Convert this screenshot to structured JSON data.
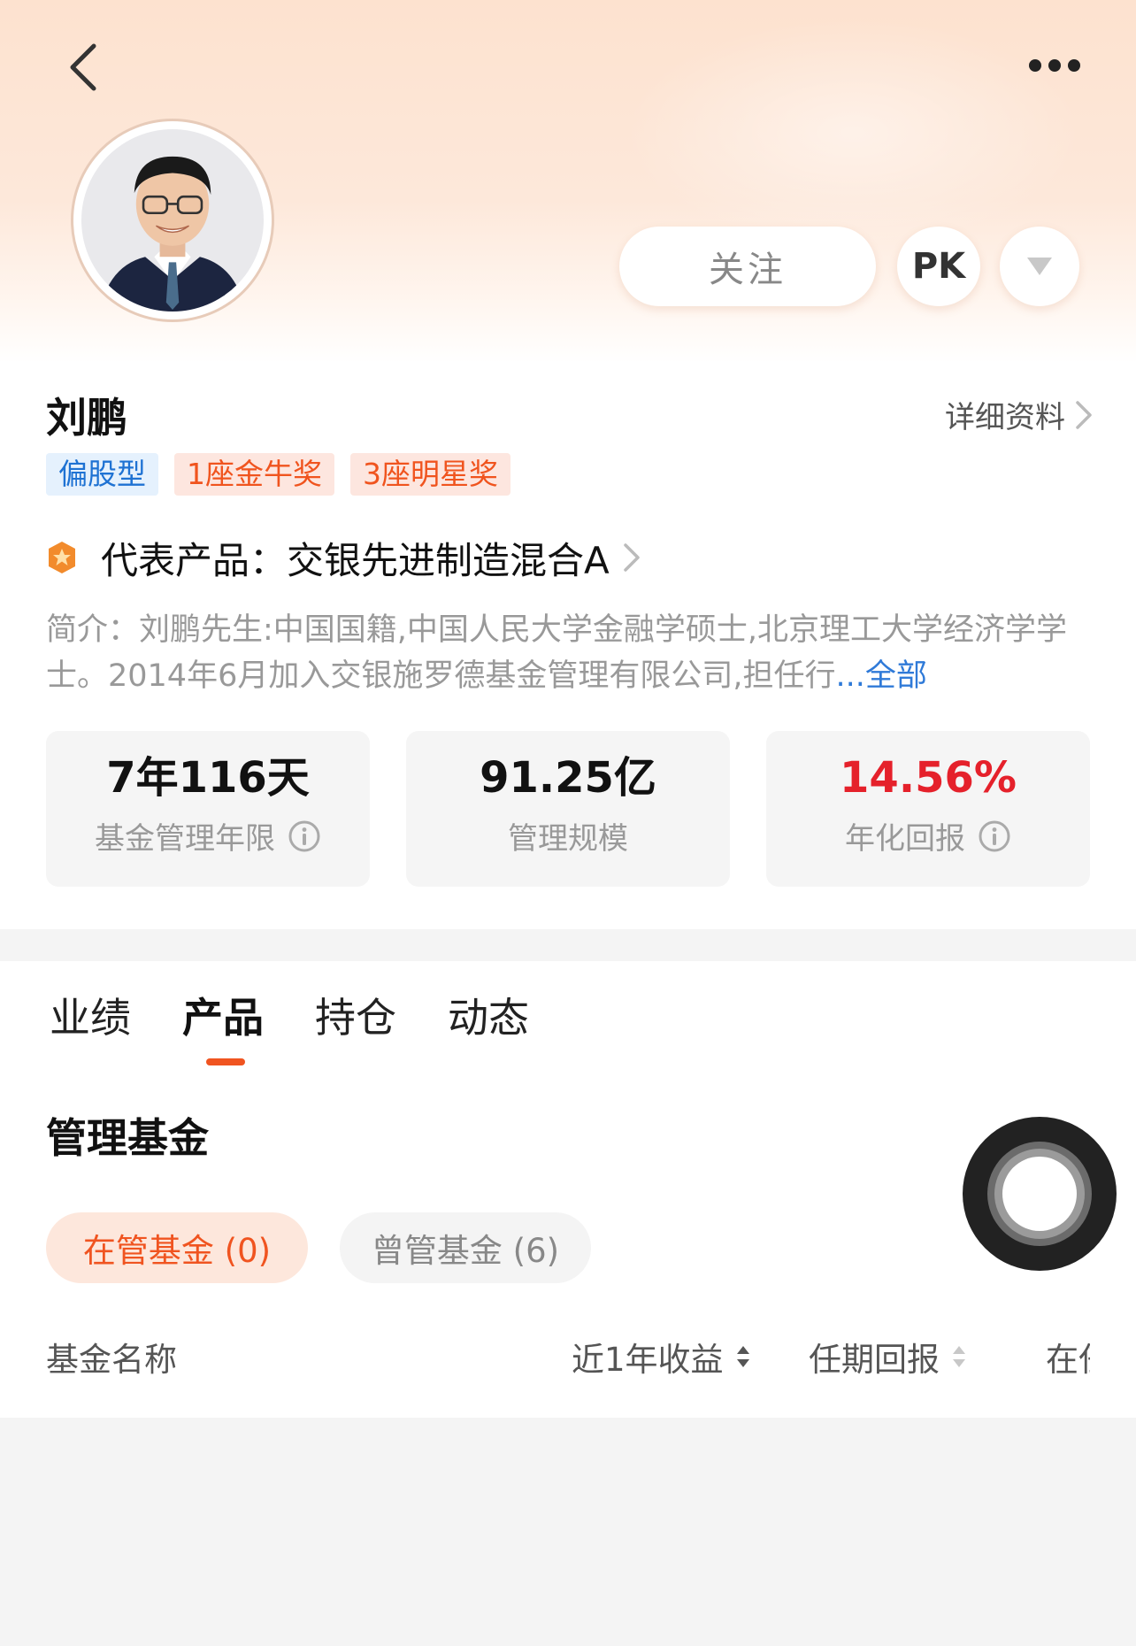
{
  "nav": {
    "back_icon": "chevron-left-icon",
    "more_icon": "more-horizontal-icon"
  },
  "actions": {
    "follow_label": "关注",
    "pk_label": "PK",
    "dropdown_icon": "triangle-down-icon"
  },
  "manager": {
    "name": "刘鹏",
    "detail_link": "详细资料",
    "tags": [
      {
        "label": "偏股型",
        "color": "#1e72d3"
      },
      {
        "label": "1座金牛奖",
        "color": "#f0541e"
      },
      {
        "label": "3座明星奖",
        "color": "#f0541e"
      }
    ],
    "rep_product_label": "代表产品：",
    "rep_product_name": "交银先进制造混合A",
    "intro_text": "简介：刘鹏先生:中国国籍,中国人民大学金融学硕士,北京理工大学经济学学士。2014年6月加入交银施罗德基金管理有限公司,担任行",
    "intro_more": "...全部"
  },
  "stats": [
    {
      "value": "7年116天",
      "label": "基金管理年限",
      "info": true
    },
    {
      "value": "91.25亿",
      "label": "管理规模",
      "info": false
    },
    {
      "value": "14.56%",
      "label": "年化回报",
      "info": true,
      "color": "#e5212b"
    }
  ],
  "tabs": [
    {
      "label": "业绩",
      "active": false
    },
    {
      "label": "产品",
      "active": true
    },
    {
      "label": "持仓",
      "active": false
    },
    {
      "label": "动态",
      "active": false
    }
  ],
  "section": {
    "title": "管理基金",
    "filters": [
      {
        "label": "在管基金 (0)",
        "active": true
      },
      {
        "label": "曾管基金 (6)",
        "active": false
      }
    ],
    "columns": {
      "name": "基金名称",
      "one_year": "近1年收益",
      "tenure": "任期回报",
      "partial": "在任"
    }
  },
  "colors": {
    "accent": "#f05420",
    "blue": "#1e72d3",
    "red": "#e5212b"
  }
}
